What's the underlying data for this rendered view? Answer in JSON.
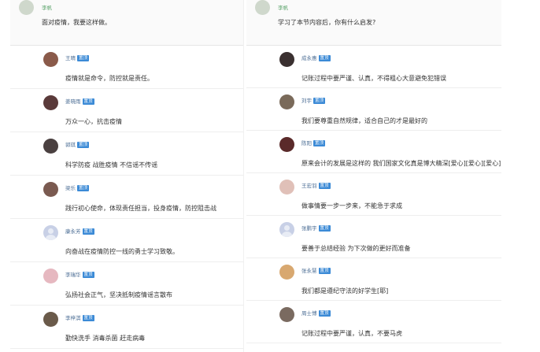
{
  "left": {
    "post": {
      "user": "李帆",
      "text": "面对疫情，我要这样做。",
      "avatar_color": "#cfd8cc"
    },
    "replies": [
      {
        "user": "王晴",
        "badge": "置顶",
        "text": "疫情就是命令，防控就是责任。",
        "avatar_color": "#8a5a4a"
      },
      {
        "user": "姜晓雨",
        "badge": "置顶",
        "text": "万众一心，抗击疫情",
        "avatar_color": "#5a3a3a"
      },
      {
        "user": "郭琪",
        "badge": "置顶",
        "text": "科学防疫 战胜疫情 不信谣不传谣",
        "avatar_color": "#4a4040"
      },
      {
        "user": "梁乐",
        "badge": "置顶",
        "text": "践行初心使命，体现责任担当，投身疫情，防控阻击战",
        "avatar_color": "#7a5a50"
      },
      {
        "user": "康永芳",
        "badge": "置顶",
        "text": "向奋战在疫情防控一线的勇士学习致敬。",
        "avatar_color": "#c8d0e6"
      },
      {
        "user": "李瑞华",
        "badge": "置顶",
        "text": "弘扬社会正气，坚决抵制疫情谣言散布",
        "avatar_color": "#e6b8c0"
      },
      {
        "user": "李梓淇",
        "badge": "置顶",
        "text": "勤快洗手 消毒杀菌 赶走病毒",
        "avatar_color": "#6a5a4a"
      }
    ]
  },
  "right": {
    "post": {
      "user": "李帆",
      "text": "学习了本节内容后，你有什么启发?",
      "avatar_color": "#cfd8cc"
    },
    "replies": [
      {
        "user": "成永惠",
        "badge": "置顶",
        "text": "记账过程中要严谨、认真，不得粗心大意避免犯错误",
        "avatar_color": "#3a3030"
      },
      {
        "user": "刘宇",
        "badge": "置顶",
        "text": "我们要尊重自然规律，适合自己的才是最好的",
        "avatar_color": "#7a6a5a"
      },
      {
        "user": "陈阳",
        "badge": "置顶",
        "text": "原来会计的发展是这样的 我们国家文化真是博大精深[爱心][爱心][爱心]",
        "avatar_color": "#5a2a2a"
      },
      {
        "user": "王宏羽",
        "badge": "置顶",
        "text": "做事情要一步一步来，不能急于求成",
        "avatar_color": "#e0c0b8"
      },
      {
        "user": "张鹏宇",
        "badge": "置顶",
        "text": "要善于总结经验 为下次做的更好而准备",
        "avatar_color": "#c8d0e6"
      },
      {
        "user": "张永慧",
        "badge": "置顶",
        "text": "我们都是遵纪守法的好学生[耶]",
        "avatar_color": "#d8a870"
      },
      {
        "user": "周士博",
        "badge": "置顶",
        "text": "记账过程中要严谨，认真，不要马虎",
        "avatar_color": "#7a6a60"
      }
    ]
  }
}
